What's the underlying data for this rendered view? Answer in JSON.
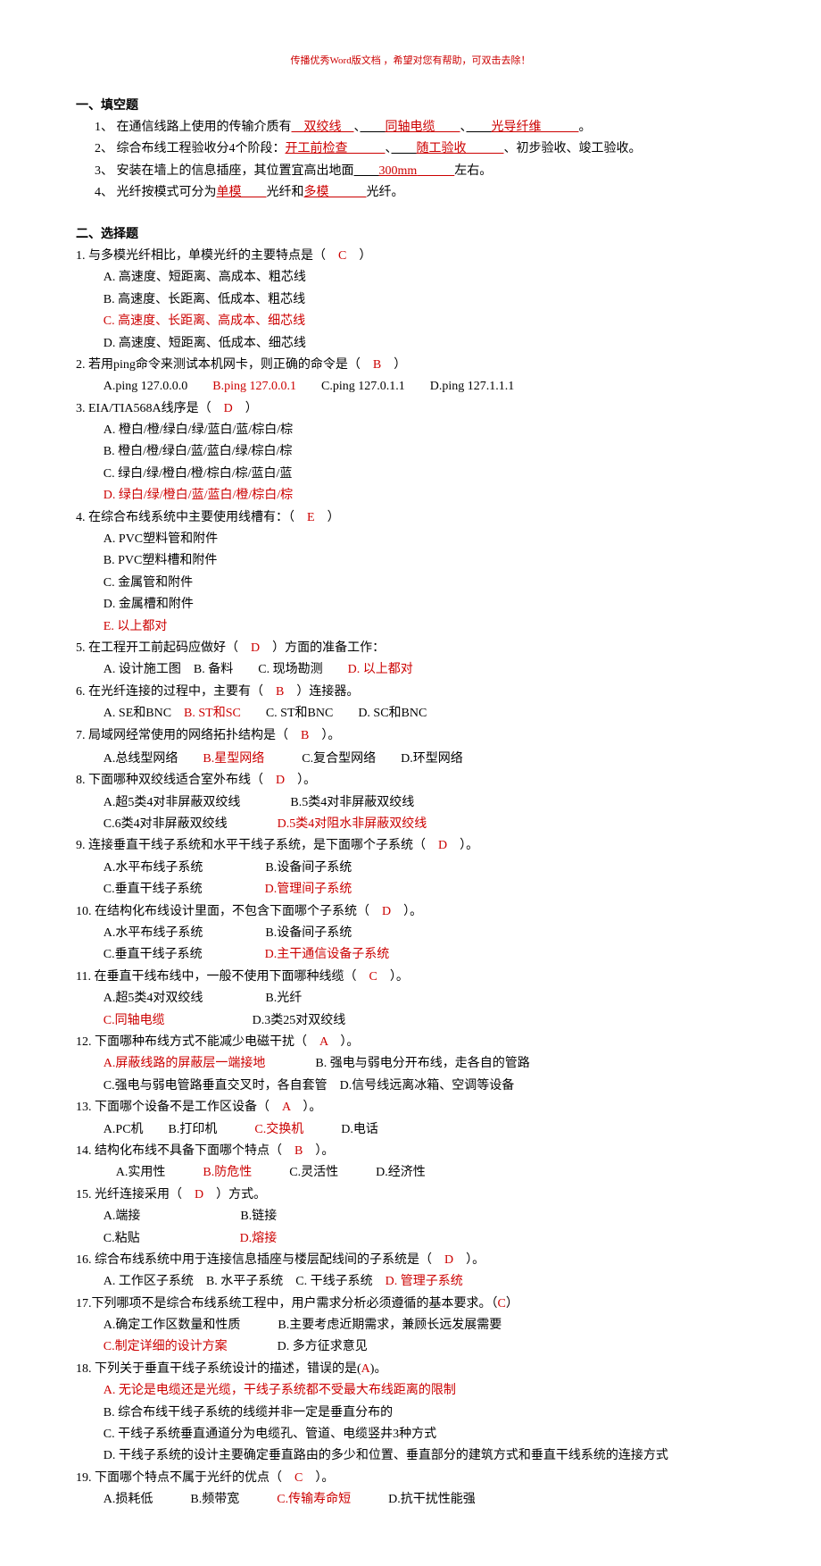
{
  "header": "传播优秀Word版文档 ，希望对您有帮助，可双击去除！",
  "s1": {
    "title": "一、填空题",
    "q1": {
      "pre": "1、 在通信线路上使用的传输介质有",
      "a1": "双绞线",
      "sep1": "、",
      "a2": "同轴电缆",
      "sep2": "、",
      "a3": "光导纤维",
      "post": "。"
    },
    "q2": {
      "pre": "2、 综合布线工程验收分4个阶段：",
      "a1": "开工前检查",
      "sep1": "、",
      "a2": "随工验收",
      "post": "、初步验收、竣工验收。"
    },
    "q3": {
      "pre": "3、 安装在墙上的信息插座，其位置宜高出地面",
      "a1": "300mm",
      "post": "左右。"
    },
    "q4": {
      "pre": "4、 光纤按模式可分为",
      "a1": "单模",
      "mid": "光纤和",
      "a2": "多模",
      "post": "光纤。"
    }
  },
  "s2": {
    "title": "二、选择题",
    "q1": {
      "text": "1.  与多模光纤相比，单模光纤的主要特点是（",
      "ans": "C",
      "post": "）",
      "a": "A. 高速度、短距离、高成本、粗芯线",
      "b": "B. 高速度、长距离、低成本、粗芯线",
      "c": "C. 高速度、长距离、高成本、细芯线",
      "d": "D. 高速度、短距离、低成本、细芯线"
    },
    "q2": {
      "text": "2.  若用ping命令来测试本机网卡，则正确的命令是（",
      "ans": "B",
      "post": "）",
      "a": "A.ping 127.0.0.0",
      "b": "B.ping 127.0.0.1",
      "c": "C.ping 127.0.1.1",
      "d": "D.ping 127.1.1.1"
    },
    "q3": {
      "text": "3.  EIA/TIA568A线序是（",
      "ans": "D",
      "post": "）",
      "a": "A. 橙白/橙/绿白/绿/蓝白/蓝/棕白/棕",
      "b": "B. 橙白/橙/绿白/蓝/蓝白/绿/棕白/棕",
      "c": "C. 绿白/绿/橙白/橙/棕白/棕/蓝白/蓝",
      "d": "D. 绿白/绿/橙白/蓝/蓝白/橙/棕白/棕"
    },
    "q4": {
      "text": "4.  在综合布线系统中主要使用线槽有：（",
      "ans": "E",
      "post": "）",
      "a": "A. PVC塑料管和附件",
      "b": "B. PVC塑料槽和附件",
      "c": "C. 金属管和附件",
      "d": "D. 金属槽和附件",
      "e": "E. 以上都对"
    },
    "q5": {
      "text": "5.  在工程开工前起码应做好（",
      "ans": "D",
      "post": "）方面的准备工作：",
      "a": "A. 设计施工图",
      "b": "B. 备料",
      "c": "C. 现场勘测",
      "d": "D. 以上都对"
    },
    "q6": {
      "text": "6.  在光纤连接的过程中，主要有（",
      "ans": "B",
      "post": "）连接器。",
      "a": "A. SE和BNC",
      "b": "B. ST和SC",
      "c": "C. ST和BNC",
      "d": "D. SC和BNC"
    },
    "q7": {
      "text": "7.  局域网经常使用的网络拓扑结构是（",
      "ans": "B",
      "post": "）。",
      "a": "A.总线型网络",
      "b": "B.星型网络",
      "c": "C.复合型网络",
      "d": "D.环型网络"
    },
    "q8": {
      "text": "8.  下面哪种双绞线适合室外布线（",
      "ans": "D",
      "post": "）。",
      "a": "A.超5类4对非屏蔽双绞线",
      "b": "B.5类4对非屏蔽双绞线",
      "c": "C.6类4对非屏蔽双绞线",
      "d": "D.5类4对阻水非屏蔽双绞线"
    },
    "q9": {
      "text": "9.  连接垂直干线子系统和水平干线子系统，是下面哪个子系统（",
      "ans": "D",
      "post": "）。",
      "a": "A.水平布线子系统",
      "b": "B.设备间子系统",
      "c": "C.垂直干线子系统",
      "d": "D.管理间子系统"
    },
    "q10": {
      "text": "10. 在结构化布线设计里面，不包含下面哪个子系统（",
      "ans": "D",
      "post": "）。",
      "a": "A.水平布线子系统",
      "b": "B.设备间子系统",
      "c": "C.垂直干线子系统",
      "d": "D.主干通信设备子系统"
    },
    "q11": {
      "text": "11. 在垂直干线布线中，一般不使用下面哪种线缆（",
      "ans": "C",
      "post": "）。",
      "a": "A.超5类4对双绞线",
      "b": "B.光纤",
      "c": "C.同轴电缆",
      "d": "D.3类25对双绞线"
    },
    "q12": {
      "text": "12. 下面哪种布线方式不能减少电磁干扰（",
      "ans": "A",
      "post": "）。",
      "a": "A.屏蔽线路的屏蔽层一端接地",
      "b": "B. 强电与弱电分开布线，走各自的管路",
      "c": "C.强电与弱电管路垂直交叉时，各自套管",
      "d": "D.信号线远离冰箱、空调等设备"
    },
    "q13": {
      "text": "13. 下面哪个设备不是工作区设备（",
      "ans": "A",
      "post": "）。",
      "a": "A.PC机",
      "b": "B.打印机",
      "c": "C.交换机",
      "d": "D.电话"
    },
    "q14": {
      "text": "14. 结构化布线不具备下面哪个特点（",
      "ans": "B",
      "post": "）。",
      "a": "A.实用性",
      "b": "B.防危性",
      "c": "C.灵活性",
      "d": "D.经济性"
    },
    "q15": {
      "text": "15. 光纤连接采用（",
      "ans": "D",
      "post": "）方式。",
      "a": "A.端接",
      "b": "B.链接",
      "c": "C.粘贴",
      "d": "D.熔接"
    },
    "q16": {
      "text": "16. 综合布线系统中用于连接信息插座与楼层配线间的子系统是（",
      "ans": "D",
      "post": "）。",
      "a": "A. 工作区子系统",
      "b": "B. 水平子系统",
      "c": "C. 干线子系统",
      "d": "D. 管理子系统"
    },
    "q17": {
      "text": "17.下列哪项不是综合布线系统工程中，用户需求分析必须遵循的基本要求。（",
      "ans": "C",
      "post": "）",
      "a": "A.确定工作区数量和性质",
      "b": "B.主要考虑近期需求，兼顾长远发展需要",
      "c": "C.制定详细的设计方案",
      "d": "D. 多方征求意见"
    },
    "q18": {
      "text": "18. 下列关于垂直干线子系统设计的描述，错误的是(",
      "ans": "A",
      "post": ")。",
      "a": "A. 无论是电缆还是光缆，干线子系统都不受最大布线距离的限制",
      "b": "B. 综合布线干线子系统的线缆并非一定是垂直分布的",
      "c": "C. 干线子系统垂直通道分为电缆孔、管道、电缆竖井3种方式",
      "d": "D. 干线子系统的设计主要确定垂直路由的多少和位置、垂直部分的建筑方式和垂直干线系统的连接方式"
    },
    "q19": {
      "text": "19. 下面哪个特点不属于光纤的优点（",
      "ans": "C",
      "post": "）。",
      "a": "A.损耗低",
      "b": "B.频带宽",
      "c": "C.传输寿命短",
      "d": "D.抗干扰性能强"
    }
  }
}
